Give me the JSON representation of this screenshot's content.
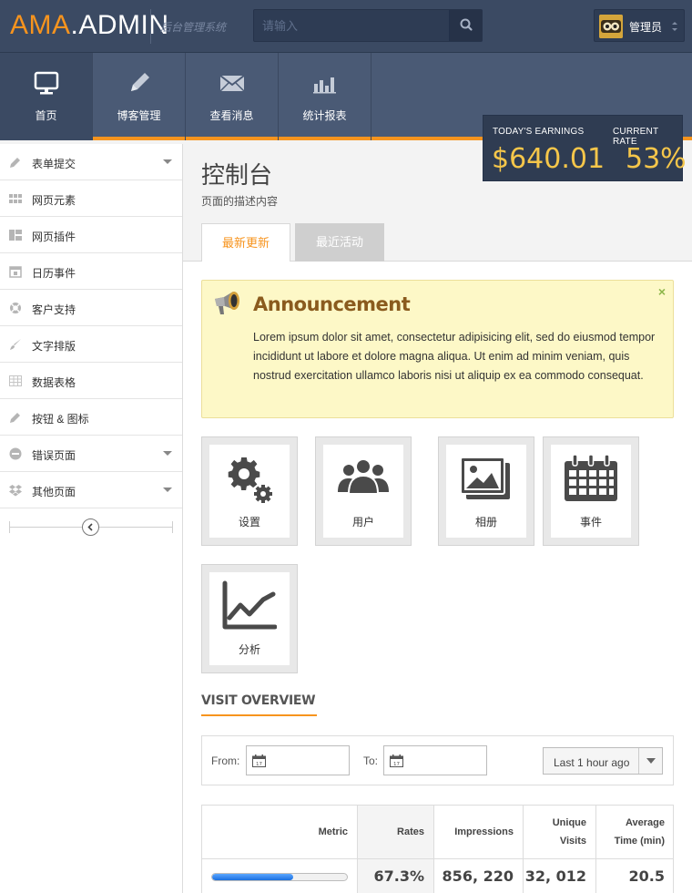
{
  "brand": {
    "part1": "AMA",
    "dot": ".",
    "part2": "ADMIN",
    "subtitle": "后台管理系统"
  },
  "search": {
    "placeholder": "请输入"
  },
  "user": {
    "name": "管理员"
  },
  "nav": {
    "items": [
      {
        "label": "首页",
        "icon": "monitor-icon",
        "active": true
      },
      {
        "label": "博客管理",
        "icon": "pencil-icon"
      },
      {
        "label": "查看消息",
        "icon": "envelope-icon"
      },
      {
        "label": "统计报表",
        "icon": "bar-chart-icon"
      }
    ]
  },
  "stats": {
    "earnings_label": "TODAY'S EARNINGS",
    "earnings_value": "$640.01",
    "rate_label": "CURRENT RATE",
    "rate_value": "53%"
  },
  "sidebar": {
    "items": [
      {
        "label": "表单提交",
        "icon": "pencil-icon",
        "has_submenu": true
      },
      {
        "label": "网页元素",
        "icon": "grid-icon"
      },
      {
        "label": "网页插件",
        "icon": "layout-icon"
      },
      {
        "label": "日历事件",
        "icon": "calendar-icon"
      },
      {
        "label": "客户支持",
        "icon": "lifebuoy-icon"
      },
      {
        "label": "文字排版",
        "icon": "brush-icon"
      },
      {
        "label": "数据表格",
        "icon": "table-icon"
      },
      {
        "label": "按钮 & 图标",
        "icon": "pencil-icon"
      },
      {
        "label": "错误页面",
        "icon": "minus-circle-icon",
        "has_submenu": true
      },
      {
        "label": "其他页面",
        "icon": "dropbox-icon",
        "has_submenu": true
      }
    ]
  },
  "page": {
    "title": "控制台",
    "description": "页面的描述内容"
  },
  "tabs": [
    {
      "label": "最新更新"
    },
    {
      "label": "最近活动"
    }
  ],
  "announcement": {
    "title": "Announcement",
    "text": "Lorem ipsum dolor sit amet, consectetur adipisicing elit, sed do eiusmod tempor incididunt ut labore et dolore magna aliqua. Ut enim ad minim veniam, quis nostrud exercitation ullamco laboris nisi ut aliquip ex ea commodo consequat.",
    "close": "×"
  },
  "tiles": [
    {
      "label": "设置",
      "icon": "gear-icon"
    },
    {
      "label": "用户",
      "icon": "users-icon"
    },
    {
      "label": "相册",
      "icon": "photo-album-icon"
    },
    {
      "label": "事件",
      "icon": "calendar-icon"
    },
    {
      "label": "分析",
      "icon": "line-chart-icon"
    }
  ],
  "visit_overview": {
    "title": "VISIT OVERVIEW",
    "from_label": "From:",
    "to_label": "To:",
    "range": "Last 1 hour ago"
  },
  "table": {
    "headers": {
      "metric": "Metric",
      "rates": "Rates",
      "impressions": "Impressions",
      "unique_1": "Unique",
      "unique_2": "Visits",
      "avg_1": "Average",
      "avg_2": "Time (min)"
    },
    "row": {
      "progress": 0.6,
      "rates": "67.3%",
      "impressions": "856, 220",
      "unique": "32, 012",
      "avg_time": "20.5"
    }
  },
  "colors": {
    "accent": "#f7941e",
    "header": "#3b4a63",
    "nav": "#4a5a75",
    "earnings": "#f5c64a"
  }
}
